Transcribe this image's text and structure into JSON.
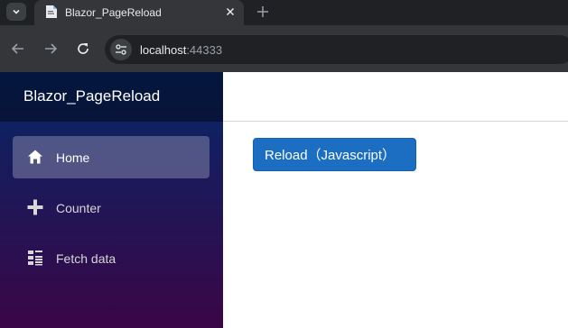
{
  "browser": {
    "tab_title": "Blazor_PageReload",
    "url_host": "localhost",
    "url_port": ":44333"
  },
  "sidebar": {
    "brand": "Blazor_PageReload",
    "items": [
      {
        "label": "Home",
        "icon": "home-icon",
        "active": true
      },
      {
        "label": "Counter",
        "icon": "plus-icon",
        "active": false
      },
      {
        "label": "Fetch data",
        "icon": "list-icon",
        "active": false
      }
    ]
  },
  "main": {
    "reload_button_label": "Reload（Javascript）"
  },
  "colors": {
    "sidebar_top": "#052767",
    "sidebar_bottom": "#3a0647",
    "button_primary": "#1b6ec2"
  }
}
